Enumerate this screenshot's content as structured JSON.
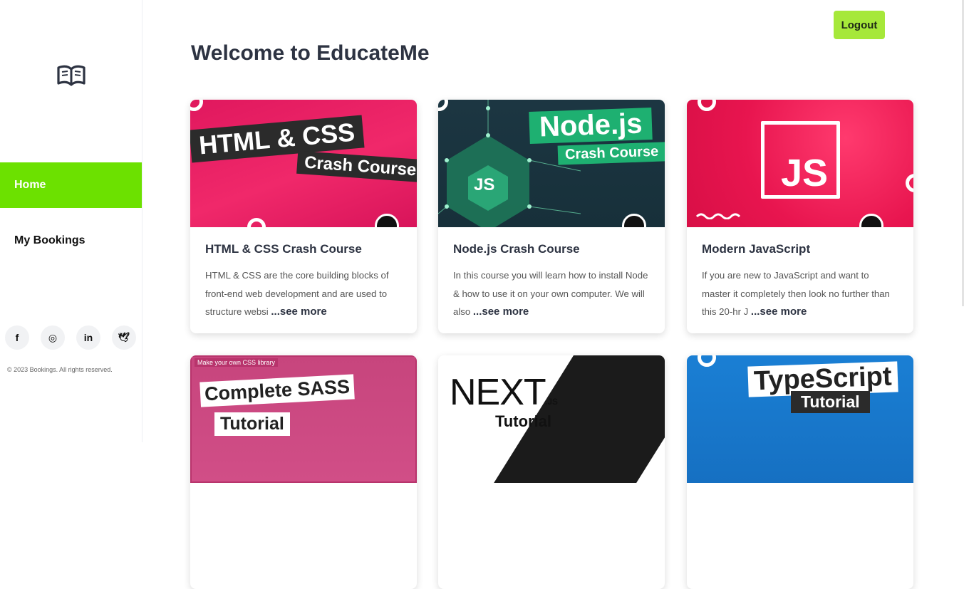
{
  "sidebar": {
    "nav": [
      {
        "label": "Home",
        "active": true
      },
      {
        "label": "My Bookings",
        "active": false
      }
    ],
    "socials": [
      {
        "icon": "facebook-icon",
        "glyph": "f"
      },
      {
        "icon": "instagram-icon",
        "glyph": "◎"
      },
      {
        "icon": "linkedin-icon",
        "glyph": "in"
      },
      {
        "icon": "twitter-icon",
        "glyph": "🕊"
      }
    ],
    "copyright": "© 2023 Bookings. All rights reserved."
  },
  "header": {
    "logout_label": "Logout",
    "title": "Welcome to EducateMe"
  },
  "courses": [
    {
      "title": "HTML & CSS Crash Course",
      "description": "HTML & CSS are the core building blocks of front-end web development and are used to structure websi",
      "see_more": "...see more",
      "thumb": {
        "line1": "HTML & CSS",
        "line2": "Crash Course"
      }
    },
    {
      "title": "Node.js Crash Course",
      "description": "In this course you will learn how to install Node & how to use it on your own computer. We will also",
      "see_more": "...see more",
      "thumb": {
        "line1": "Node.js",
        "line2": "Crash Course",
        "hex_label": "JS"
      }
    },
    {
      "title": "Modern JavaScript",
      "description": "If you are new to JavaScript and want to master it completely then look no further than this 20-hr J",
      "see_more": "...see more",
      "thumb": {
        "logo": "JS"
      }
    },
    {
      "thumb": {
        "tag": "Make your own CSS library",
        "line1": "Complete SASS",
        "line2": "Tutorial"
      }
    },
    {
      "thumb": {
        "line1": "NEXT",
        "suffix": ".JS",
        "line2": "Tutorial"
      }
    },
    {
      "thumb": {
        "line1": "TypeScript",
        "line2": "Tutorial"
      }
    }
  ],
  "colors": {
    "accent_green": "#6ce100",
    "logout_green": "#a6e83a",
    "text_dark": "#2d3342"
  }
}
